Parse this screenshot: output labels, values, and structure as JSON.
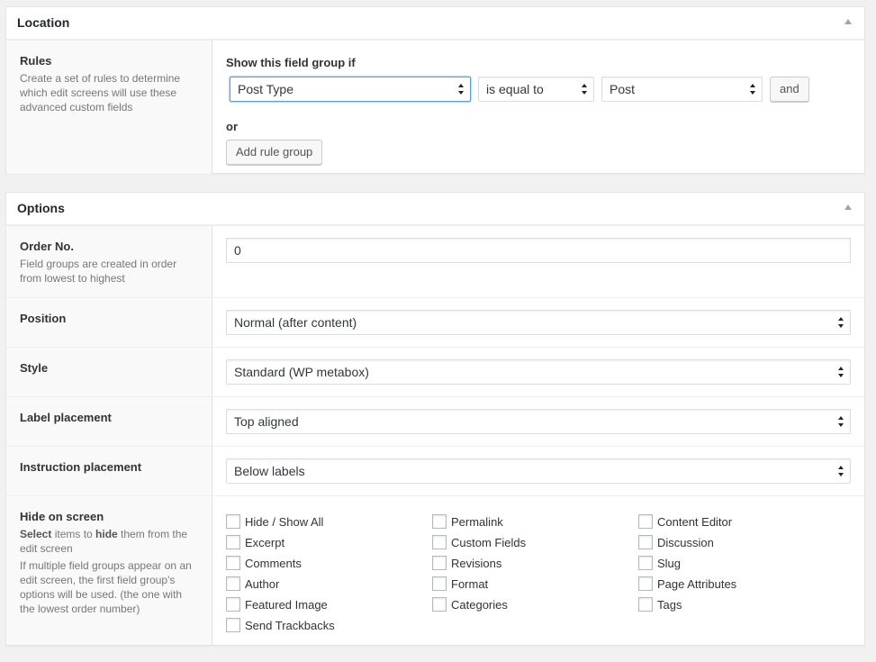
{
  "location": {
    "title": "Location",
    "rules_label": "Rules",
    "rules_desc": "Create a set of rules to determine which edit screens will use these advanced custom fields",
    "show_if": "Show this field group if",
    "param": "Post Type",
    "operator": "is equal to",
    "value": "Post",
    "and_button": "and",
    "or_label": "or",
    "add_rule_group": "Add rule group"
  },
  "options": {
    "title": "Options",
    "order": {
      "label": "Order No.",
      "desc": "Field groups are created in order from lowest to highest",
      "value": "0"
    },
    "position": {
      "label": "Position",
      "value": "Normal (after content)"
    },
    "style": {
      "label": "Style",
      "value": "Standard (WP metabox)"
    },
    "label_placement": {
      "label": "Label placement",
      "value": "Top aligned"
    },
    "instruction_placement": {
      "label": "Instruction placement",
      "value": "Below labels"
    },
    "hide_on_screen": {
      "label": "Hide on screen",
      "desc_select": "Select",
      "desc_mid": " items to ",
      "desc_hide": "hide",
      "desc_end": " them from the edit screen",
      "desc2": "If multiple field groups appear on an edit screen, the first field group's options will be used. (the one with the lowest order number)",
      "items": [
        "Hide / Show All",
        "Permalink",
        "Content Editor",
        "Excerpt",
        "Custom Fields",
        "Discussion",
        "Comments",
        "Revisions",
        "Slug",
        "Author",
        "Format",
        "Page Attributes",
        "Featured Image",
        "Categories",
        "Tags",
        "Send Trackbacks"
      ]
    }
  }
}
